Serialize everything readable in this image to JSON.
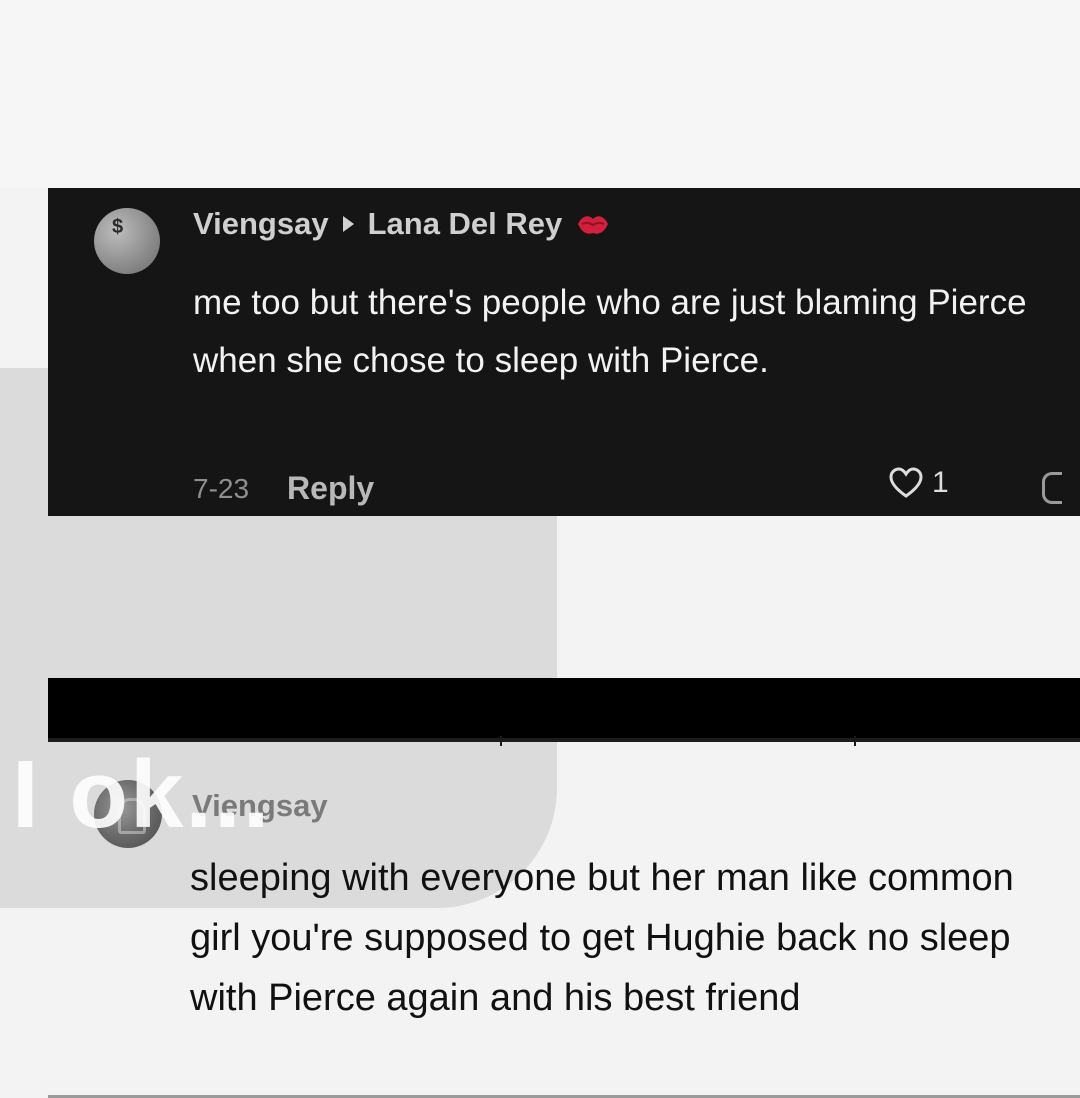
{
  "overlay": {
    "text": "I ok..."
  },
  "comment_reply": {
    "author": "Viengsay",
    "reply_to": "Lana Del Rey",
    "text": "me too but there's people who are just blaming Pierce when she chose to sleep with Pierce.",
    "date": "7-23",
    "reply_label": "Reply",
    "like_count": "1"
  },
  "comment_second": {
    "author": "Viengsay",
    "text": "sleeping with everyone but her man like common girl you're supposed to get Hughie back no sleep with Pierce again and his best friend"
  },
  "icons": {
    "avatar_1": "avatar-icon",
    "reply_arrow": "arrow-right-icon",
    "lips": "lips-icon",
    "heart": "heart-icon",
    "partial": "comment-icon",
    "avatar_2": "avatar-icon"
  },
  "colors": {
    "dark_card": "#151515",
    "black_bar": "#000000",
    "lips_red": "#d21f3c"
  }
}
